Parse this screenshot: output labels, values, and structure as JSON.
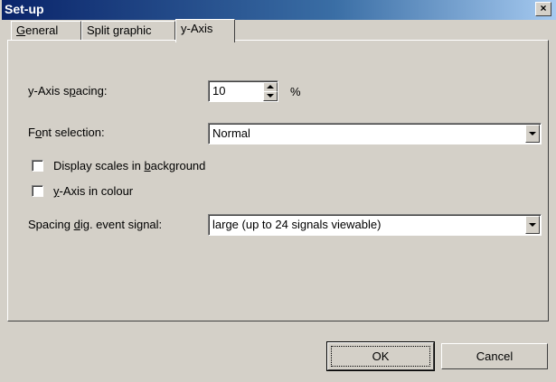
{
  "window": {
    "title": "Set-up",
    "close_glyph": "×"
  },
  "tabs": [
    {
      "label_pre": "",
      "label_u": "G",
      "label_post": "eneral",
      "active": false
    },
    {
      "label_pre": "Split graphic",
      "label_u": "",
      "label_post": "",
      "active": false
    },
    {
      "label_pre": "y-Axis",
      "label_u": "",
      "label_post": "",
      "active": true
    }
  ],
  "y_axis_spacing": {
    "label_pre": "y-Axis s",
    "label_u": "p",
    "label_post": "acing:",
    "value": "10",
    "unit": "%"
  },
  "font_selection": {
    "label_pre": "F",
    "label_u": "o",
    "label_post": "nt selection:",
    "value": "Normal"
  },
  "display_scales": {
    "label_pre": "Display scales in ",
    "label_u": "b",
    "label_post": "ackground",
    "checked": false
  },
  "y_axis_colour": {
    "label_pre": "",
    "label_u": "y",
    "label_post": "-Axis in colour",
    "checked": false
  },
  "spacing_event": {
    "label_pre": "Spacing ",
    "label_u": "d",
    "label_post": "ig. event signal:",
    "value": "large (up to 24 signals viewable)"
  },
  "buttons": {
    "ok": "OK",
    "cancel": "Cancel"
  },
  "colors": {
    "titlebar_start": "#0a246a",
    "titlebar_end": "#a6caf0",
    "face": "#d4d0c8"
  }
}
